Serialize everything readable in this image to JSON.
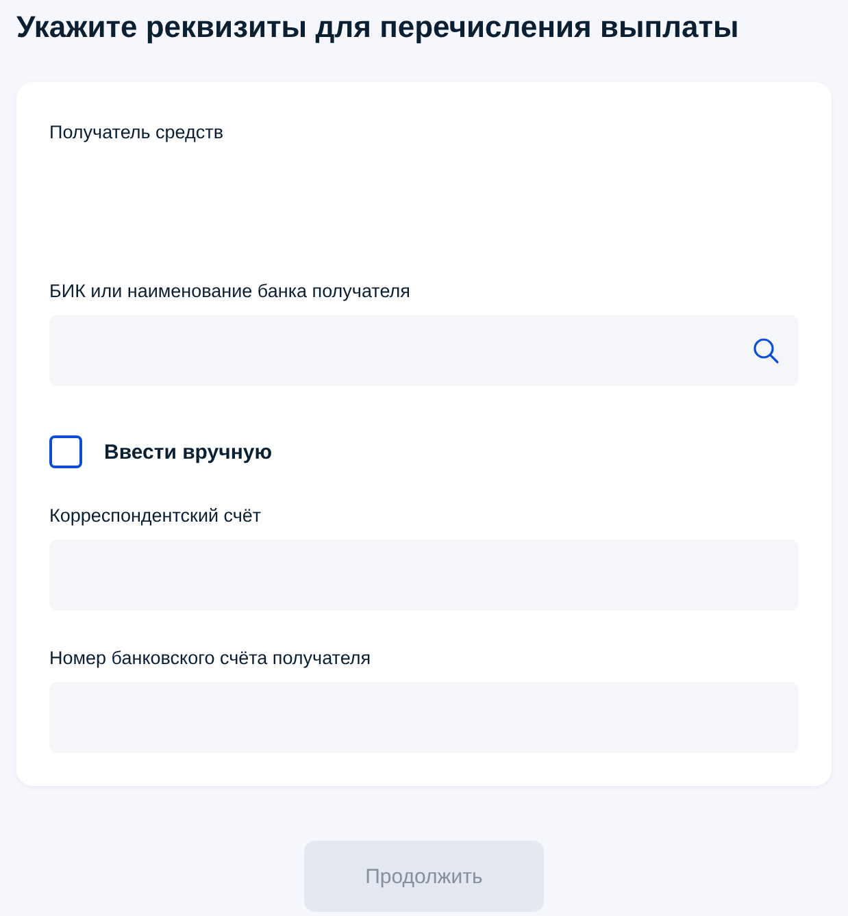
{
  "title": "Укажите реквизиты для перечисления выплаты",
  "form": {
    "recipient_label": "Получатель средств",
    "bank_field": {
      "label": "БИК или наименование банка получателя"
    },
    "manual_entry": {
      "label": "Ввести вручную",
      "checked": false
    },
    "fields": [
      {
        "label": "Корреспондентский счёт"
      },
      {
        "label": "Номер банковского счёта получателя"
      }
    ]
  },
  "continue_button": {
    "label": "Продолжить",
    "disabled": true
  }
}
